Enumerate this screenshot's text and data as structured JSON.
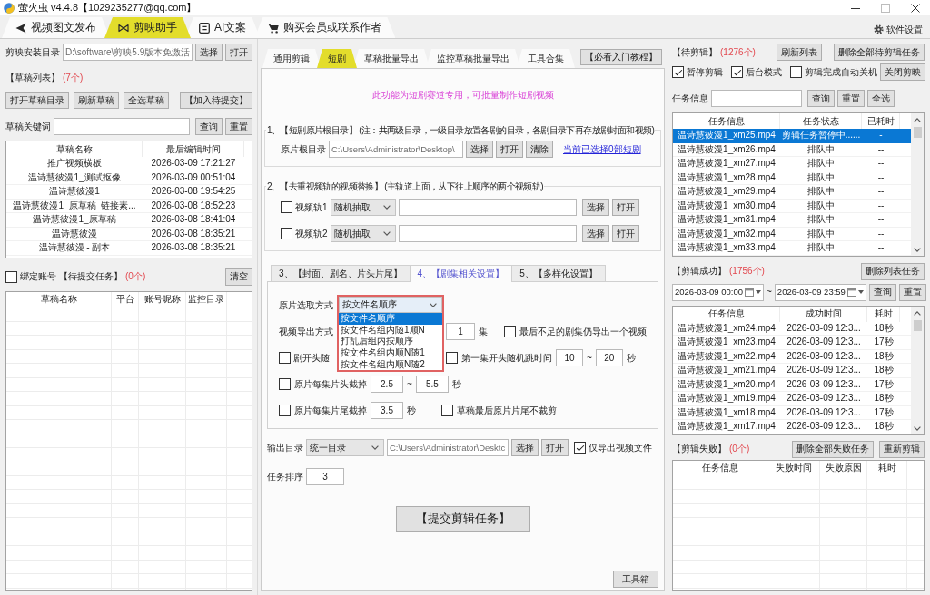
{
  "window": {
    "title": "萤火虫 v4.4.8【1029235277@qq.com】"
  },
  "main_tabs": [
    {
      "label": "视频图文发布",
      "selected": false
    },
    {
      "label": "剪映助手",
      "selected": true
    },
    {
      "label": "AI文案",
      "selected": false
    },
    {
      "label": "购买会员或联系作者",
      "selected": false
    }
  ],
  "settings_link": "软件设置",
  "left": {
    "install_dir": {
      "label": "剪映安装目录",
      "value": "D:\\software\\剪映5.9版本免激活",
      "buttons": [
        "选择",
        "打开"
      ]
    },
    "drafts": {
      "title": "【草稿列表】",
      "count": "(7个)",
      "buttons": [
        "打开草稿目录",
        "刷新草稿",
        "全选草稿",
        "【加入待提交】"
      ],
      "search": {
        "label": "草稿关键词",
        "buttons": [
          "查询",
          "重置"
        ]
      },
      "table": {
        "columns": [
          "草稿名称",
          "最后编辑时间"
        ],
        "rows": [
          [
            "推广视频横板",
            "2026-03-09 17:21:27"
          ],
          [
            "温诗慧彼漫1_测试抠像",
            "2026-03-09 00:51:04"
          ],
          [
            "温诗慧彼漫1",
            "2026-03-08 19:54:25"
          ],
          [
            "温诗慧彼漫1_原草稿_链接素...",
            "2026-03-08 18:52:23"
          ],
          [
            "温诗慧彼漫1_原草稿",
            "2026-03-08 18:41:04"
          ],
          [
            "温诗慧彼漫",
            "2026-03-08 18:35:21"
          ],
          [
            "温诗慧彼漫 - 副本",
            "2026-03-08 18:35:21"
          ]
        ]
      }
    },
    "pending": {
      "bind": {
        "label": "绑定账号",
        "checked": false
      },
      "title": "【待提交任务】",
      "count": "(0个)",
      "clear_button": "清空",
      "table": {
        "columns": [
          "草稿名称",
          "平台",
          "账号昵称",
          "监控目录"
        ]
      }
    }
  },
  "center": {
    "tabs": [
      {
        "label": "通用剪辑",
        "selected": false
      },
      {
        "label": "短剧",
        "selected": true
      },
      {
        "label": "草稿批量导出",
        "selected": false
      },
      {
        "label": "监控草稿批量导出",
        "selected": false
      },
      {
        "label": "工具合集",
        "selected": false
      }
    ],
    "tutorial_button": "【必看入门教程】",
    "notice": "此功能为短剧赛道专用，可批量制作短剧视频",
    "source_dir": {
      "title": "1、【短剧原片根目录】 (注：共两级目录，一级目录放置各剧的目录，各剧目录下再存放剧封面和视频)",
      "label": "原片根目录",
      "value": "C:\\Users\\Administrator\\Desktop\\",
      "buttons": [
        "选择",
        "打开",
        "清除"
      ],
      "link": "当前已选择0部短剧"
    },
    "track_replace": {
      "title": "2、【去重视频轨的视频替换】 (主轨道上面，从下往上顺序的两个视频轨)",
      "tracks": [
        {
          "label": "视频轨1",
          "checked": false,
          "mode": "随机抽取",
          "buttons": [
            "选择",
            "打开"
          ]
        },
        {
          "label": "视频轨2",
          "checked": false,
          "mode": "随机抽取",
          "buttons": [
            "选择",
            "打开"
          ]
        }
      ]
    },
    "settings_tabs": [
      {
        "label": "3、【封面、剧名、片头片尾】",
        "selected": false
      },
      {
        "label": "4、【剧集相关设置】",
        "selected": true
      },
      {
        "label": "5、【多样化设置】",
        "selected": false
      }
    ],
    "episode_settings": {
      "source_select": {
        "label": "原片选取方式",
        "value": "按文件名顺序",
        "expanded": true,
        "highlighted": true,
        "options": [
          {
            "label": "按文件名顺序",
            "selected": true
          },
          {
            "label": "按文件名组内随1顺N",
            "selected": false
          },
          {
            "label": "打乱后组内按顺序",
            "selected": false
          },
          {
            "label": "按文件名组内顺N随1",
            "selected": false
          },
          {
            "label": "按文件名组内顺N随2",
            "selected": false
          }
        ]
      },
      "export_mode": {
        "label": "视频导出方式",
        "count": "1",
        "unit": "集",
        "keep_remainder": {
          "label": "最后不足的剧集仍导出一个视频",
          "checked": false
        }
      },
      "random_start": {
        "label": "剧开头随",
        "checked": false
      },
      "first_skip": {
        "label": "第一集开头随机跳时间",
        "checked": false,
        "from": "10",
        "separator": "~",
        "to": "20",
        "unit": "秒"
      },
      "head_trim": {
        "label": "原片每集片头截掉",
        "checked": false,
        "from": "2.5",
        "separator": "~",
        "to": "5.5",
        "unit": "秒"
      },
      "tail_trim": {
        "label": "原片每集片尾截掉",
        "checked": false,
        "value": "3.5",
        "unit": "秒",
        "keep_last": {
          "label": "草稿最后原片片尾不裁剪",
          "checked": false
        }
      }
    },
    "output": {
      "label": "输出目录",
      "mode": "统一目录",
      "value": "C:\\Users\\Administrator\\Desktc",
      "buttons": [
        "选择",
        "打开"
      ],
      "video_only": {
        "label": "仅导出视频文件",
        "checked": true
      }
    },
    "task_order": {
      "label": "任务排序",
      "value": "3"
    },
    "submit_button": "【提交剪辑任务】",
    "toolbox_button": "工具箱"
  },
  "right": {
    "queue": {
      "title": "【待剪辑】",
      "count": "(1276个)",
      "buttons": [
        "刷新列表",
        "删除全部待剪辑任务"
      ],
      "options": [
        {
          "label": "暂停剪辑",
          "checked": true
        },
        {
          "label": "后台模式",
          "checked": true
        },
        {
          "label": "剪辑完成自动关机",
          "checked": false
        }
      ],
      "close_button": "关闭剪映",
      "search": {
        "label": "任务信息",
        "buttons": [
          "查询",
          "重置",
          "全选"
        ]
      },
      "table": {
        "columns": [
          "任务信息",
          "任务状态",
          "已耗时"
        ],
        "rows": [
          {
            "cells": [
              "温诗慧彼漫1_xm25.mp4",
              "剪辑任务暂停中......",
              "-"
            ],
            "selected": true
          },
          {
            "cells": [
              "温诗慧彼漫1_xm26.mp4",
              "排队中",
              "--"
            ],
            "selected": false
          },
          {
            "cells": [
              "温诗慧彼漫1_xm27.mp4",
              "排队中",
              "--"
            ],
            "selected": false
          },
          {
            "cells": [
              "温诗慧彼漫1_xm28.mp4",
              "排队中",
              "--"
            ],
            "selected": false
          },
          {
            "cells": [
              "温诗慧彼漫1_xm29.mp4",
              "排队中",
              "--"
            ],
            "selected": false
          },
          {
            "cells": [
              "温诗慧彼漫1_xm30.mp4",
              "排队中",
              "--"
            ],
            "selected": false
          },
          {
            "cells": [
              "温诗慧彼漫1_xm31.mp4",
              "排队中",
              "--"
            ],
            "selected": false
          },
          {
            "cells": [
              "温诗慧彼漫1_xm32.mp4",
              "排队中",
              "--"
            ],
            "selected": false
          },
          {
            "cells": [
              "温诗慧彼漫1_xm33.mp4",
              "排队中",
              "--"
            ],
            "selected": false
          }
        ]
      }
    },
    "success": {
      "title": "【剪辑成功】",
      "count": "(1756个)",
      "delete_button": "删除列表任务",
      "date_from": "2026-03-09 00:00",
      "separator": "~",
      "date_to": "2026-03-09 23:59",
      "buttons": [
        "查询",
        "重置"
      ],
      "table": {
        "columns": [
          "任务信息",
          "成功时间",
          "耗时"
        ],
        "rows": [
          [
            "温诗慧彼漫1_xm24.mp4",
            "2026-03-09 12:3...",
            "18秒"
          ],
          [
            "温诗慧彼漫1_xm23.mp4",
            "2026-03-09 12:3...",
            "17秒"
          ],
          [
            "温诗慧彼漫1_xm22.mp4",
            "2026-03-09 12:3...",
            "18秒"
          ],
          [
            "温诗慧彼漫1_xm21.mp4",
            "2026-03-09 12:3...",
            "18秒"
          ],
          [
            "温诗慧彼漫1_xm20.mp4",
            "2026-03-09 12:3...",
            "17秒"
          ],
          [
            "温诗慧彼漫1_xm19.mp4",
            "2026-03-09 12:3...",
            "18秒"
          ],
          [
            "温诗慧彼漫1_xm18.mp4",
            "2026-03-09 12:3...",
            "17秒"
          ],
          [
            "温诗慧彼漫1_xm17.mp4",
            "2026-03-09 12:3...",
            "18秒"
          ]
        ]
      }
    },
    "failed": {
      "title": "【剪辑失败】",
      "count": "(0个)",
      "buttons": [
        "删除全部失败任务",
        "重新剪辑"
      ],
      "table": {
        "columns": [
          "任务信息",
          "失败时间",
          "失败原因",
          "耗时"
        ]
      }
    }
  }
}
